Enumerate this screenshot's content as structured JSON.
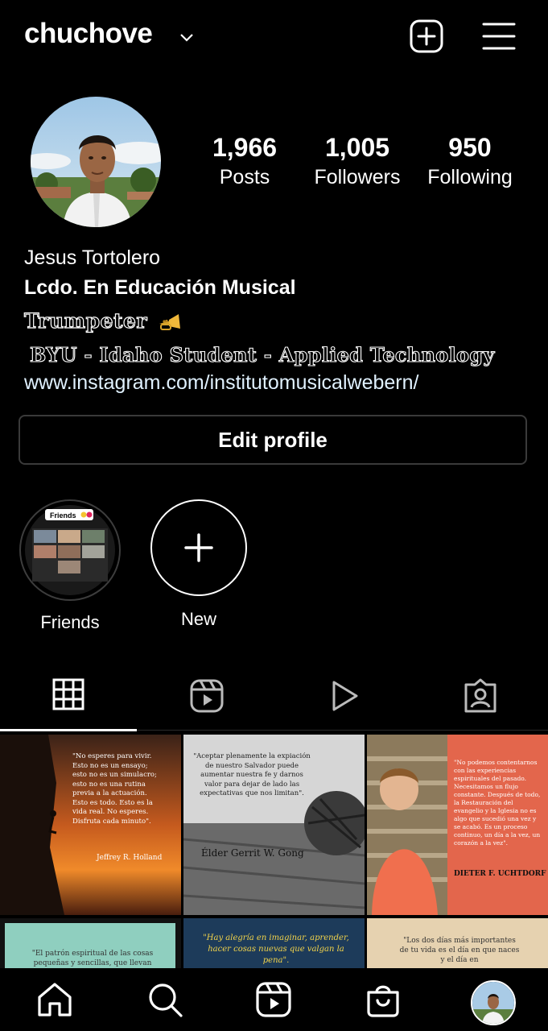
{
  "header": {
    "username": "chuchove",
    "add_icon": "plus-square-icon",
    "menu_icon": "hamburger-menu-icon"
  },
  "profile": {
    "stats": [
      {
        "value": "1,966",
        "label": "Posts"
      },
      {
        "value": "1,005",
        "label": "Followers"
      },
      {
        "value": "950",
        "label": "Following"
      }
    ],
    "name": "Jesus Tortolero",
    "title": "Lcdo. En Educación Musical",
    "bio_line1": "Trumpeter",
    "bio_line2": "BYU - Idaho Student - Applied Technology",
    "link": "www.instagram.com/institutomusicalwebern/",
    "edit_button": "Edit profile"
  },
  "highlights": [
    {
      "label": "Friends",
      "cover_text": "Friends"
    },
    {
      "label": "New"
    }
  ],
  "tabs": [
    {
      "icon": "grid-icon",
      "active": true
    },
    {
      "icon": "reels-icon",
      "active": false
    },
    {
      "icon": "play-icon",
      "active": false
    },
    {
      "icon": "tagged-icon",
      "active": false
    }
  ],
  "posts": [
    {
      "quote": "\"No esperes para vivir. Esto no es un ensayo; esto no es un simulacro; esto no es una rutina previa a la actuación. Esto es todo. Esto es la vida real. No esperes. Disfruta cada minuto\".",
      "author": "Jeffrey R. Holland"
    },
    {
      "quote": "\"Aceptar plenamente la expiación de nuestro Salvador puede aumentar nuestra fe y darnos valor para dejar de lado las expectativas que nos limitan\".",
      "author": "Élder Gerrit W. Gong"
    },
    {
      "quote": "\"No podemos contentarnos con las experiencias espirituales del pasado. Necesitamos un flujo constante. Después de todo, la Restauración del evangelio y la Iglesia no es algo que sucedió una vez y se acabó. Es un proceso continuo, un día a la vez, un corazón a la vez\".",
      "author": "DIETER F. UCHTDORF"
    },
    {
      "quote": "\"El patrón espiritual de las cosas pequeñas y sencillas, que llevan"
    },
    {
      "quote": "\"Hay alegría en imaginar, aprender, hacer cosas nuevas que valgan la pena\"."
    },
    {
      "quote": "\"Los dos días más importantes de tu vida es el día en que naces y el día en"
    }
  ],
  "bottom_nav": [
    "home-icon",
    "search-icon",
    "reels-icon",
    "shop-icon",
    "profile-avatar"
  ],
  "colors": {
    "background": "#000000",
    "text": "#ffffff",
    "link": "#e0f1ff",
    "border": "#3a3a3a"
  }
}
